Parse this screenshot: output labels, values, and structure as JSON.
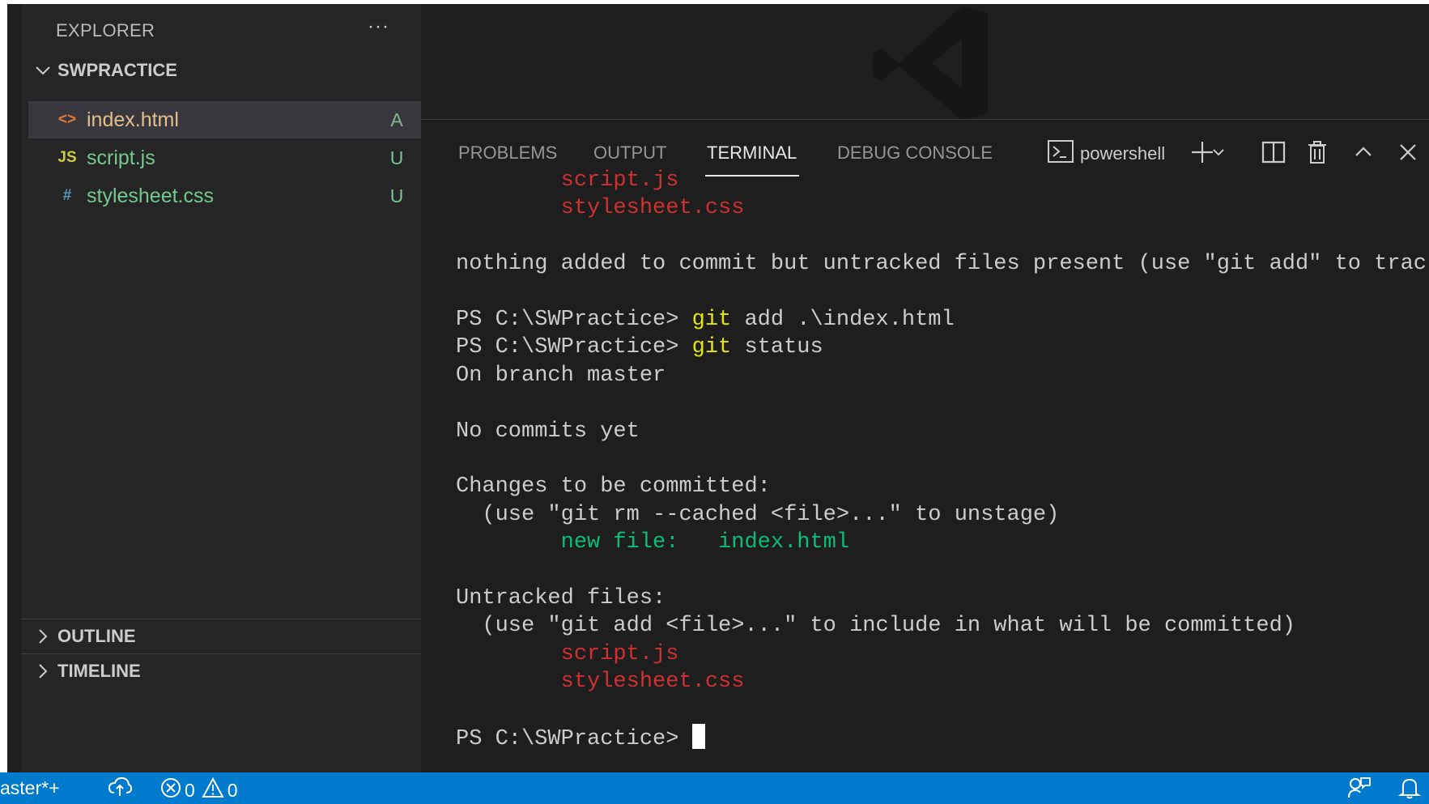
{
  "explorer": {
    "title": "EXPLORER",
    "more_label": "···",
    "folder": "SWPRACTICE",
    "files": [
      {
        "icon": "<>",
        "name": "index.html",
        "status": "A",
        "icon_color": "#e37933",
        "name_color": "#e2c08d",
        "status_color": "#81b88b"
      },
      {
        "icon": "JS",
        "name": "script.js",
        "status": "U",
        "icon_color": "#cbcb41",
        "name_color": "#73c991",
        "status_color": "#73c991"
      },
      {
        "icon": "#",
        "name": "stylesheet.css",
        "status": "U",
        "icon_color": "#519aba",
        "name_color": "#73c991",
        "status_color": "#73c991"
      }
    ],
    "outline": "OUTLINE",
    "timeline": "TIMELINE"
  },
  "panel": {
    "tabs": [
      "PROBLEMS",
      "OUTPUT",
      "TERMINAL",
      "DEBUG CONSOLE"
    ],
    "active_tab": "TERMINAL",
    "shell_name": "powershell"
  },
  "terminal": {
    "lines": [
      [
        {
          "t": "        "
        },
        {
          "t": "script.js",
          "c": "red"
        }
      ],
      [
        {
          "t": "        "
        },
        {
          "t": "stylesheet.css",
          "c": "red"
        }
      ],
      [
        {
          "t": ""
        }
      ],
      [
        {
          "t": "nothing added to commit but untracked files present (use \"git add\" to track)"
        }
      ],
      [
        {
          "t": ""
        }
      ],
      [
        {
          "t": "PS C:\\SWPractice> "
        },
        {
          "t": "git",
          "c": "yellow"
        },
        {
          "t": " add .\\index.html"
        }
      ],
      [
        {
          "t": "PS C:\\SWPractice> "
        },
        {
          "t": "git",
          "c": "yellow"
        },
        {
          "t": " status"
        }
      ],
      [
        {
          "t": "On branch master"
        }
      ],
      [
        {
          "t": ""
        }
      ],
      [
        {
          "t": "No commits yet"
        }
      ],
      [
        {
          "t": ""
        }
      ],
      [
        {
          "t": "Changes to be committed:"
        }
      ],
      [
        {
          "t": "  (use \"git rm --cached <file>...\" to unstage)"
        }
      ],
      [
        {
          "t": "        "
        },
        {
          "t": "new file:   index.html",
          "c": "green"
        }
      ],
      [
        {
          "t": ""
        }
      ],
      [
        {
          "t": "Untracked files:"
        }
      ],
      [
        {
          "t": "  (use \"git add <file>...\" to include in what will be committed)"
        }
      ],
      [
        {
          "t": "        "
        },
        {
          "t": "script.js",
          "c": "red"
        }
      ],
      [
        {
          "t": "        "
        },
        {
          "t": "stylesheet.css",
          "c": "red"
        }
      ],
      [
        {
          "t": ""
        }
      ],
      [
        {
          "t": "PS C:\\SWPractice> "
        }
      ]
    ]
  },
  "statusbar": {
    "branch": "aster*+",
    "errors": "0",
    "warnings": "0"
  },
  "colors": {
    "accent": "#007acc",
    "sidebar_bg": "#252526",
    "editor_bg": "#1e1e1e"
  }
}
